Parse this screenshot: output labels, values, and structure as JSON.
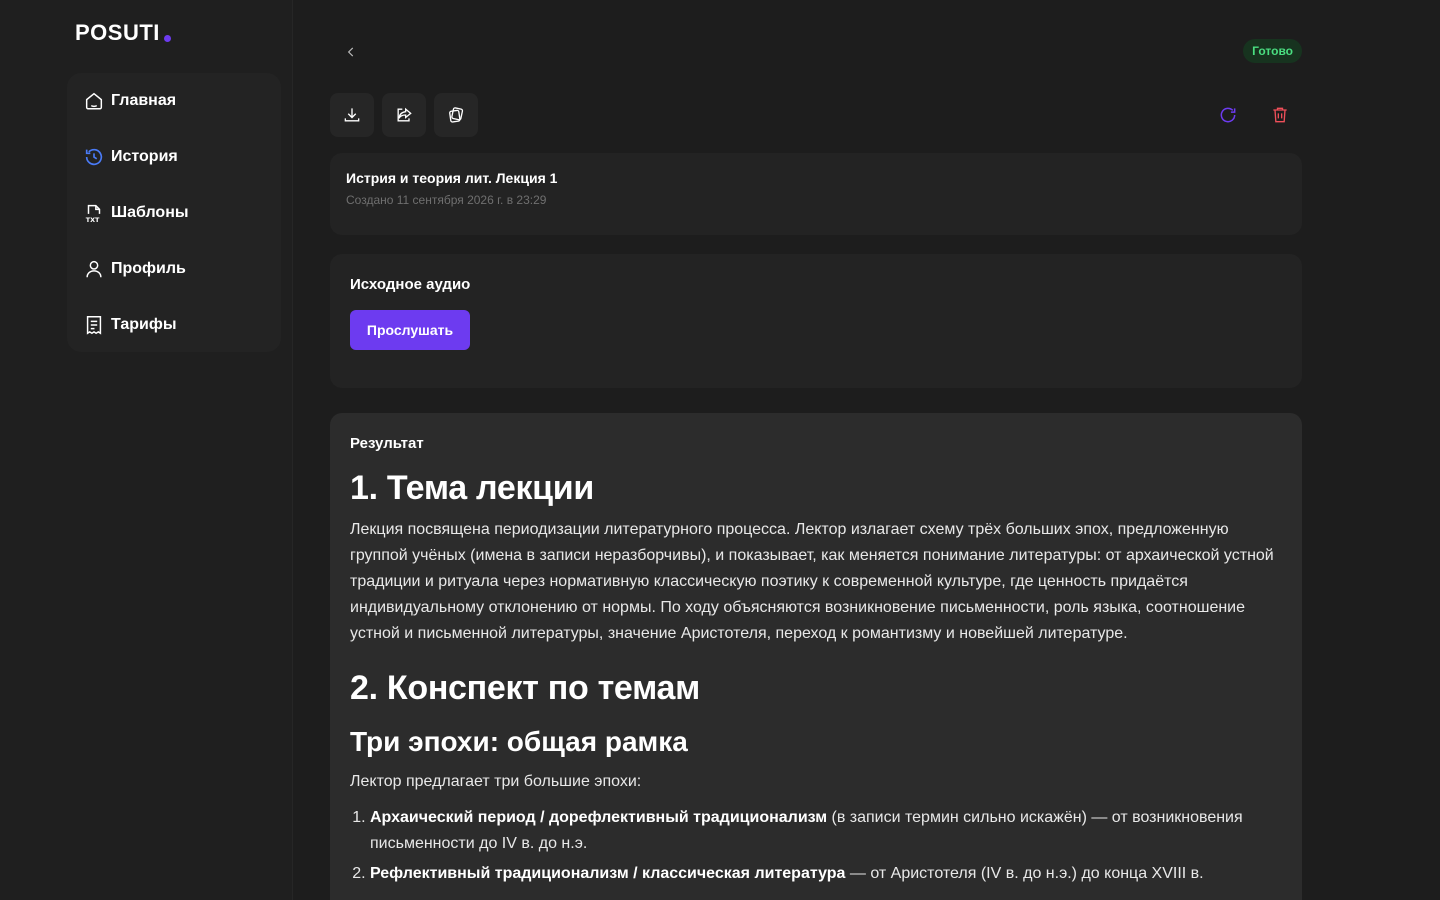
{
  "app": {
    "logo_text": "POSUTI",
    "accent_color": "#6d3bf0"
  },
  "sidebar": {
    "items": [
      {
        "label": "Главная",
        "icon": "home-icon"
      },
      {
        "label": "История",
        "icon": "history-icon"
      },
      {
        "label": "Шаблоны",
        "icon": "template-icon"
      },
      {
        "label": "Профиль",
        "icon": "user-icon"
      },
      {
        "label": "Тарифы",
        "icon": "receipt-icon"
      }
    ]
  },
  "header": {
    "status": "Готово",
    "status_color": "#4ade80"
  },
  "toolbar": {
    "download_icon": "download-icon",
    "share_icon": "share-icon",
    "copy_icon": "copy-icon",
    "refresh_icon": "refresh-icon",
    "delete_icon": "trash-icon"
  },
  "record": {
    "title": "Истрия и теория лит. Лекция 1",
    "created": "Создано 11 сентября 2026 г. в 23:29"
  },
  "audio": {
    "title": "Исходное аудио",
    "listen_label": "Прослушать"
  },
  "result": {
    "label": "Результат",
    "h1_topic": "1. Тема лекции",
    "topic_text": "Лекция посвящена периодизации литературного процесса. Лектор излагает схему трёх больших эпох, предложенную группой учёных (имена в записи неразборчивы), и показывает, как меняется понимание литературы: от архаической устной традиции и ритуала через нормативную классическую поэтику к современной культуре, где ценность придаётся индивидуальному отклонению от нормы. По ходу объясняются возникновение письменности, роль языка, соотношение устной и письменной литературы, значение Аристотеля, переход к романтизму и новейшей литературе.",
    "h1_summary": "2. Конспект по темам",
    "h2_epochs": "Три эпохи: общая рамка",
    "epochs_intro": "Лектор предлагает три большие эпохи:",
    "list": [
      {
        "bold": "Архаический период / дорефлективный традиционализм",
        "rest": " (в записи термин сильно искажён) — от возникновения письменности до IV в. до н.э."
      },
      {
        "bold": "Рефлективный традиционализм / классическая литература",
        "rest": " — от Аристотеля (IV в. до н.э.) до конца XVIII в."
      }
    ]
  }
}
